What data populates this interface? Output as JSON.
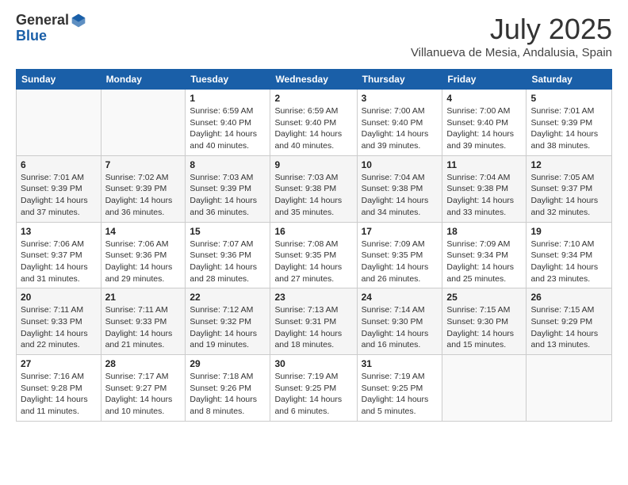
{
  "logo": {
    "general": "General",
    "blue": "Blue"
  },
  "header": {
    "month": "July 2025",
    "location": "Villanueva de Mesia, Andalusia, Spain"
  },
  "weekdays": [
    "Sunday",
    "Monday",
    "Tuesday",
    "Wednesday",
    "Thursday",
    "Friday",
    "Saturday"
  ],
  "weeks": [
    [
      {
        "day": "",
        "sunrise": "",
        "sunset": "",
        "daylight": ""
      },
      {
        "day": "",
        "sunrise": "",
        "sunset": "",
        "daylight": ""
      },
      {
        "day": "1",
        "sunrise": "Sunrise: 6:59 AM",
        "sunset": "Sunset: 9:40 PM",
        "daylight": "Daylight: 14 hours and 40 minutes."
      },
      {
        "day": "2",
        "sunrise": "Sunrise: 6:59 AM",
        "sunset": "Sunset: 9:40 PM",
        "daylight": "Daylight: 14 hours and 40 minutes."
      },
      {
        "day": "3",
        "sunrise": "Sunrise: 7:00 AM",
        "sunset": "Sunset: 9:40 PM",
        "daylight": "Daylight: 14 hours and 39 minutes."
      },
      {
        "day": "4",
        "sunrise": "Sunrise: 7:00 AM",
        "sunset": "Sunset: 9:40 PM",
        "daylight": "Daylight: 14 hours and 39 minutes."
      },
      {
        "day": "5",
        "sunrise": "Sunrise: 7:01 AM",
        "sunset": "Sunset: 9:39 PM",
        "daylight": "Daylight: 14 hours and 38 minutes."
      }
    ],
    [
      {
        "day": "6",
        "sunrise": "Sunrise: 7:01 AM",
        "sunset": "Sunset: 9:39 PM",
        "daylight": "Daylight: 14 hours and 37 minutes."
      },
      {
        "day": "7",
        "sunrise": "Sunrise: 7:02 AM",
        "sunset": "Sunset: 9:39 PM",
        "daylight": "Daylight: 14 hours and 36 minutes."
      },
      {
        "day": "8",
        "sunrise": "Sunrise: 7:03 AM",
        "sunset": "Sunset: 9:39 PM",
        "daylight": "Daylight: 14 hours and 36 minutes."
      },
      {
        "day": "9",
        "sunrise": "Sunrise: 7:03 AM",
        "sunset": "Sunset: 9:38 PM",
        "daylight": "Daylight: 14 hours and 35 minutes."
      },
      {
        "day": "10",
        "sunrise": "Sunrise: 7:04 AM",
        "sunset": "Sunset: 9:38 PM",
        "daylight": "Daylight: 14 hours and 34 minutes."
      },
      {
        "day": "11",
        "sunrise": "Sunrise: 7:04 AM",
        "sunset": "Sunset: 9:38 PM",
        "daylight": "Daylight: 14 hours and 33 minutes."
      },
      {
        "day": "12",
        "sunrise": "Sunrise: 7:05 AM",
        "sunset": "Sunset: 9:37 PM",
        "daylight": "Daylight: 14 hours and 32 minutes."
      }
    ],
    [
      {
        "day": "13",
        "sunrise": "Sunrise: 7:06 AM",
        "sunset": "Sunset: 9:37 PM",
        "daylight": "Daylight: 14 hours and 31 minutes."
      },
      {
        "day": "14",
        "sunrise": "Sunrise: 7:06 AM",
        "sunset": "Sunset: 9:36 PM",
        "daylight": "Daylight: 14 hours and 29 minutes."
      },
      {
        "day": "15",
        "sunrise": "Sunrise: 7:07 AM",
        "sunset": "Sunset: 9:36 PM",
        "daylight": "Daylight: 14 hours and 28 minutes."
      },
      {
        "day": "16",
        "sunrise": "Sunrise: 7:08 AM",
        "sunset": "Sunset: 9:35 PM",
        "daylight": "Daylight: 14 hours and 27 minutes."
      },
      {
        "day": "17",
        "sunrise": "Sunrise: 7:09 AM",
        "sunset": "Sunset: 9:35 PM",
        "daylight": "Daylight: 14 hours and 26 minutes."
      },
      {
        "day": "18",
        "sunrise": "Sunrise: 7:09 AM",
        "sunset": "Sunset: 9:34 PM",
        "daylight": "Daylight: 14 hours and 25 minutes."
      },
      {
        "day": "19",
        "sunrise": "Sunrise: 7:10 AM",
        "sunset": "Sunset: 9:34 PM",
        "daylight": "Daylight: 14 hours and 23 minutes."
      }
    ],
    [
      {
        "day": "20",
        "sunrise": "Sunrise: 7:11 AM",
        "sunset": "Sunset: 9:33 PM",
        "daylight": "Daylight: 14 hours and 22 minutes."
      },
      {
        "day": "21",
        "sunrise": "Sunrise: 7:11 AM",
        "sunset": "Sunset: 9:33 PM",
        "daylight": "Daylight: 14 hours and 21 minutes."
      },
      {
        "day": "22",
        "sunrise": "Sunrise: 7:12 AM",
        "sunset": "Sunset: 9:32 PM",
        "daylight": "Daylight: 14 hours and 19 minutes."
      },
      {
        "day": "23",
        "sunrise": "Sunrise: 7:13 AM",
        "sunset": "Sunset: 9:31 PM",
        "daylight": "Daylight: 14 hours and 18 minutes."
      },
      {
        "day": "24",
        "sunrise": "Sunrise: 7:14 AM",
        "sunset": "Sunset: 9:30 PM",
        "daylight": "Daylight: 14 hours and 16 minutes."
      },
      {
        "day": "25",
        "sunrise": "Sunrise: 7:15 AM",
        "sunset": "Sunset: 9:30 PM",
        "daylight": "Daylight: 14 hours and 15 minutes."
      },
      {
        "day": "26",
        "sunrise": "Sunrise: 7:15 AM",
        "sunset": "Sunset: 9:29 PM",
        "daylight": "Daylight: 14 hours and 13 minutes."
      }
    ],
    [
      {
        "day": "27",
        "sunrise": "Sunrise: 7:16 AM",
        "sunset": "Sunset: 9:28 PM",
        "daylight": "Daylight: 14 hours and 11 minutes."
      },
      {
        "day": "28",
        "sunrise": "Sunrise: 7:17 AM",
        "sunset": "Sunset: 9:27 PM",
        "daylight": "Daylight: 14 hours and 10 minutes."
      },
      {
        "day": "29",
        "sunrise": "Sunrise: 7:18 AM",
        "sunset": "Sunset: 9:26 PM",
        "daylight": "Daylight: 14 hours and 8 minutes."
      },
      {
        "day": "30",
        "sunrise": "Sunrise: 7:19 AM",
        "sunset": "Sunset: 9:25 PM",
        "daylight": "Daylight: 14 hours and 6 minutes."
      },
      {
        "day": "31",
        "sunrise": "Sunrise: 7:19 AM",
        "sunset": "Sunset: 9:25 PM",
        "daylight": "Daylight: 14 hours and 5 minutes."
      },
      {
        "day": "",
        "sunrise": "",
        "sunset": "",
        "daylight": ""
      },
      {
        "day": "",
        "sunrise": "",
        "sunset": "",
        "daylight": ""
      }
    ]
  ]
}
